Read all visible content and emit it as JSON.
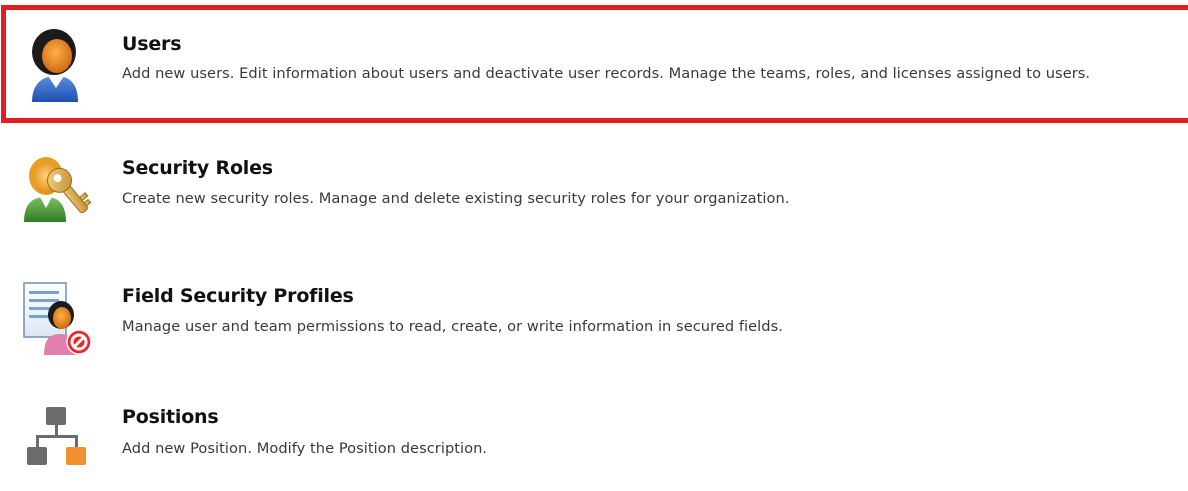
{
  "items": [
    {
      "icon": "user-icon",
      "title": "Users",
      "description": "Add new users. Edit information about users and deactivate user records. Manage the teams, roles, and licenses assigned to users."
    },
    {
      "icon": "security-roles-key-icon",
      "title": "Security Roles",
      "description": "Create new security roles. Manage and delete existing security roles for your organization."
    },
    {
      "icon": "field-security-profile-icon",
      "title": "Field Security Profiles",
      "description": "Manage user and team permissions to read, create, or write information in secured fields."
    },
    {
      "icon": "hierarchy-icon",
      "title": "Positions",
      "description": "Add new Position. Modify the Position description."
    }
  ],
  "highlight_color": "#e11d24"
}
